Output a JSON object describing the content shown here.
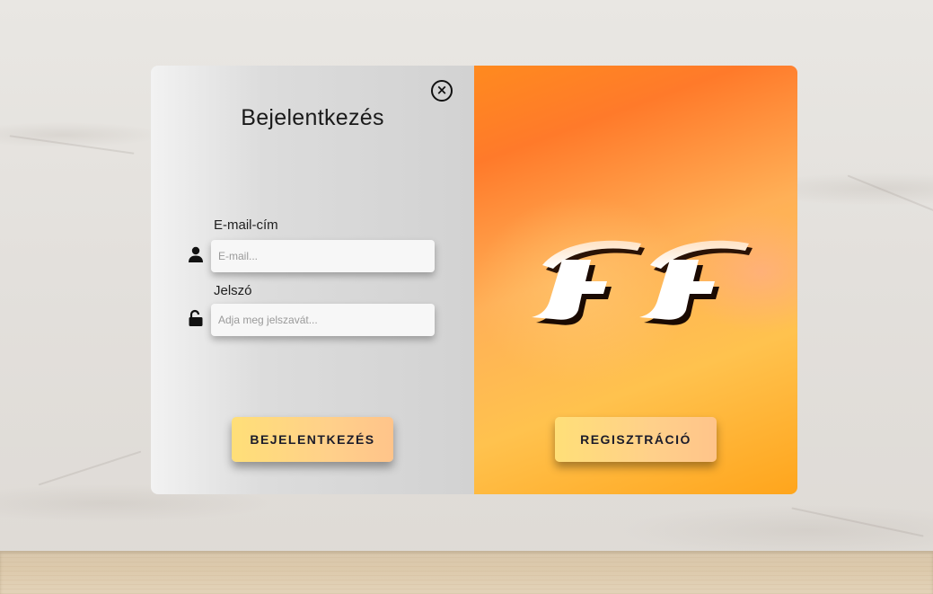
{
  "login": {
    "title": "Bejelentkezés",
    "close_icon": "close-circle-icon",
    "email": {
      "label": "E-mail-cím",
      "placeholder": "E-mail...",
      "value": "",
      "icon": "user-icon"
    },
    "password": {
      "label": "Jelszó",
      "placeholder": "Adja meg jelszavát...",
      "value": "",
      "icon": "unlock-icon"
    },
    "submit_label": "BEJELENTKEZÉS"
  },
  "register": {
    "logo_text": "FF",
    "button_label": "REGISZTRÁCIÓ"
  },
  "colors": {
    "accent_orange": "#ff8a1f",
    "button_yellow": "#ffdf78",
    "panel_gray": "#d2d2d2"
  }
}
